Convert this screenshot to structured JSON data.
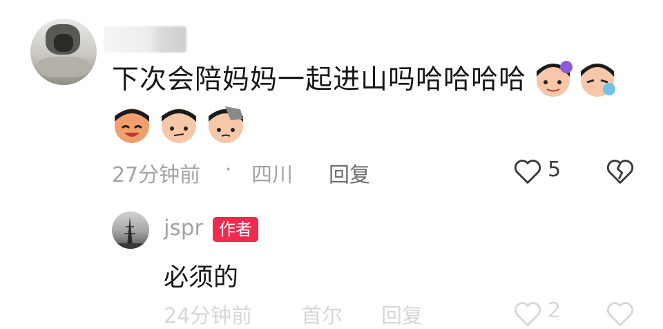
{
  "comment": {
    "text": "下次会陪妈妈一起进山吗哈哈哈哈",
    "time": "27分钟前",
    "separator": "·",
    "location": "四川",
    "reply_label": "回复",
    "like_count": "5",
    "inline_stickers": [
      "sticker-girl-purple",
      "sticker-girl-blue"
    ],
    "stickers": [
      "sticker-laughing",
      "sticker-smirk",
      "sticker-rock"
    ]
  },
  "reply": {
    "username": "jspr",
    "badge": "作者",
    "text": "必须的",
    "time_partial": "24分钟前",
    "location_partial": "首尔",
    "reply_label": "回复",
    "like_partial": "2"
  },
  "colors": {
    "badge": "#f12a4e",
    "meta": "#a3a3a3",
    "text": "#161616"
  }
}
